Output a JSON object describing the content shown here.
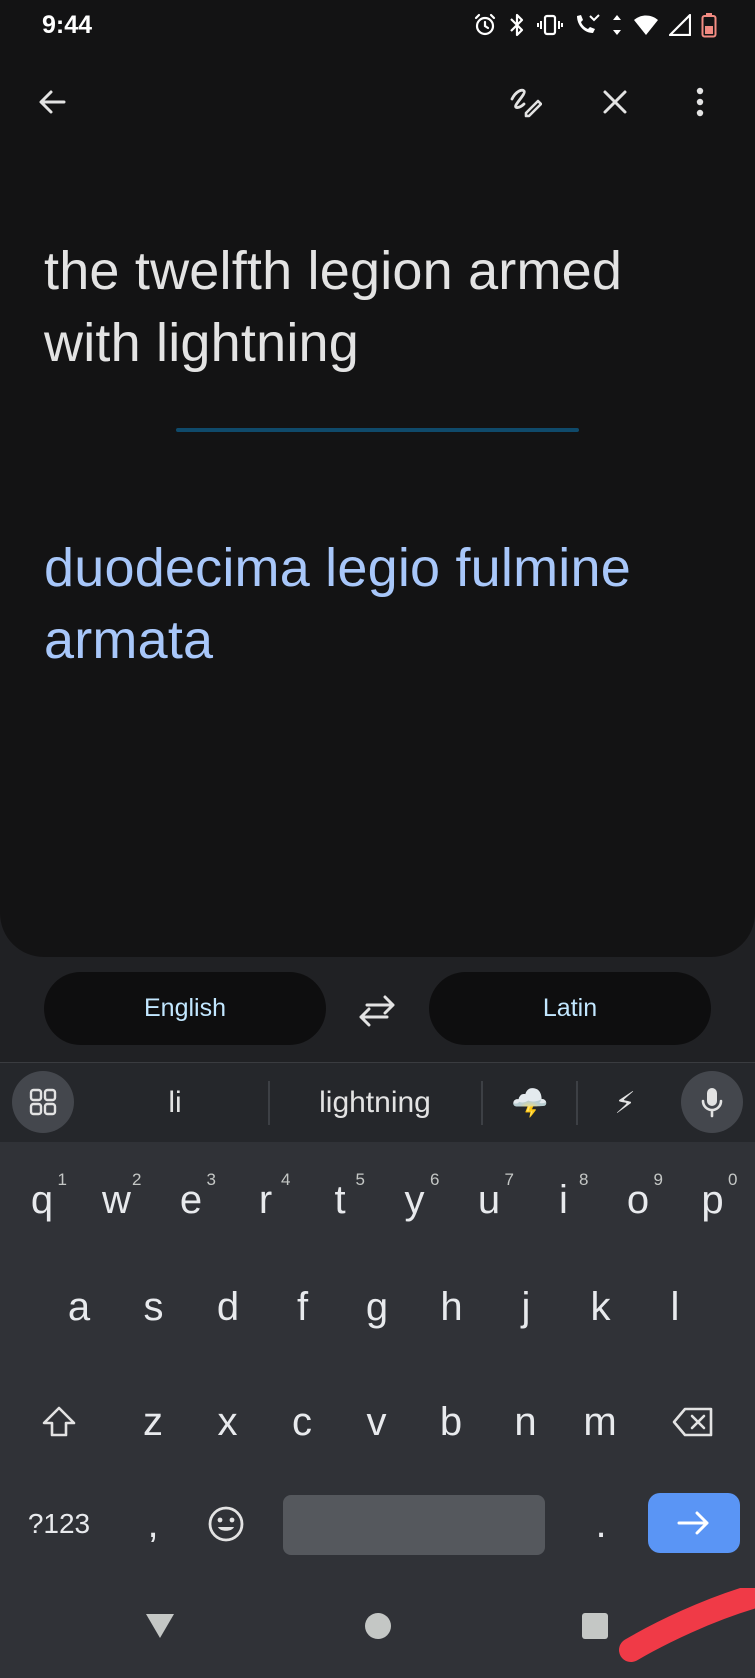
{
  "status_bar": {
    "time": "9:44"
  },
  "translation": {
    "source_text": "the twelfth legion armed with lightning",
    "target_text": "duodecima legio fulmine armata"
  },
  "languages": {
    "source": "English",
    "target": "Latin"
  },
  "keyboard": {
    "suggestions": [
      "li",
      "lightning",
      "🌩️",
      "⚡"
    ],
    "row1": [
      {
        "key": "q",
        "hint": "1"
      },
      {
        "key": "w",
        "hint": "2"
      },
      {
        "key": "e",
        "hint": "3"
      },
      {
        "key": "r",
        "hint": "4"
      },
      {
        "key": "t",
        "hint": "5"
      },
      {
        "key": "y",
        "hint": "6"
      },
      {
        "key": "u",
        "hint": "7"
      },
      {
        "key": "i",
        "hint": "8"
      },
      {
        "key": "o",
        "hint": "9"
      },
      {
        "key": "p",
        "hint": "0"
      }
    ],
    "row2": [
      "a",
      "s",
      "d",
      "f",
      "g",
      "h",
      "j",
      "k",
      "l"
    ],
    "row3": [
      "z",
      "x",
      "c",
      "v",
      "b",
      "n",
      "m"
    ],
    "symbols_label": "?123",
    "comma": ",",
    "period": "."
  },
  "colors": {
    "background": "#131314",
    "source_text": "#e3e3e3",
    "target_text": "#a8c7fa",
    "language_text": "#c2e7ff",
    "enter_key": "#5a95f5"
  },
  "icons": {
    "toolbar": [
      "back-arrow-icon",
      "handwriting-icon",
      "close-icon",
      "more-vert-icon"
    ],
    "language_bar": [
      "swap-icon"
    ],
    "keyboard": [
      "apps-grid-icon",
      "mic-icon",
      "shift-icon",
      "backspace-icon",
      "emoji-icon",
      "arrow-right-icon"
    ],
    "nav": [
      "nav-back-icon",
      "nav-home-icon",
      "nav-recents-icon"
    ]
  }
}
